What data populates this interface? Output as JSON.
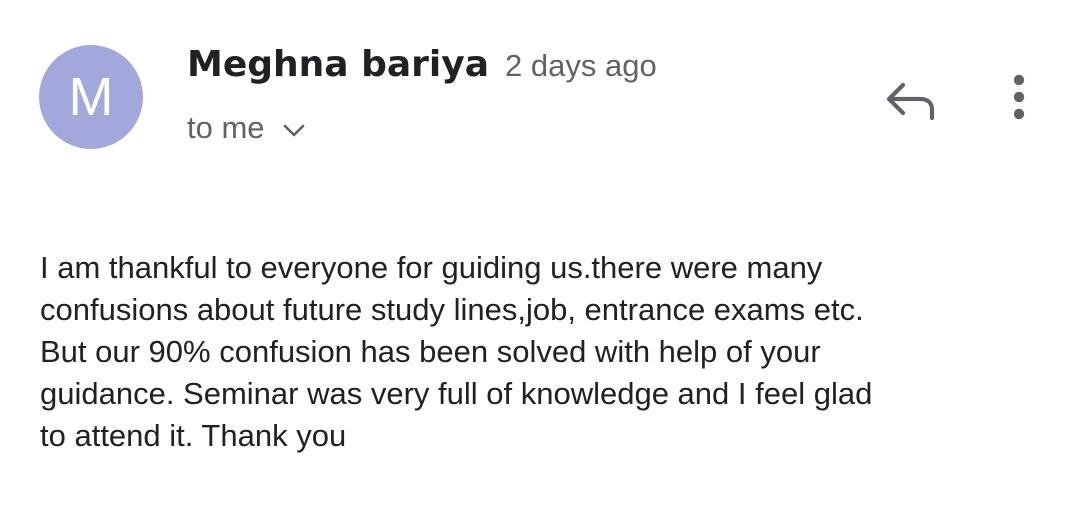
{
  "message": {
    "avatar_letter": "M",
    "avatar_color": "#a3a8dc",
    "sender_name": "Meghna bariya",
    "time": "2 days ago",
    "recipient": "to me",
    "body": "I am thankful to everyone for guiding us.there were many\nconfusions about future study lines,job, entrance exams etc.\nBut our 90% confusion has been solved with help of your\nguidance. Seminar was very full of knowledge and I feel glad\nto attend it. Thank you"
  },
  "actions": {
    "reply_icon": "reply-icon",
    "more_icon": "more-vert-icon",
    "expand_icon": "chevron-down-icon"
  }
}
